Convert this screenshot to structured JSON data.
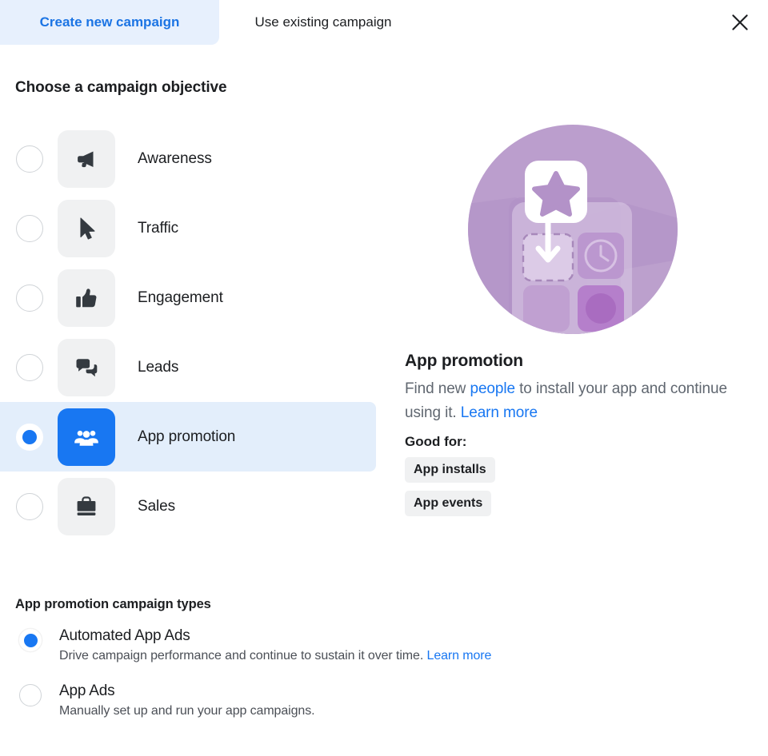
{
  "tabs": {
    "create_new": "Create new campaign",
    "use_existing": "Use existing campaign",
    "close_icon": "close-icon"
  },
  "objective_section": {
    "title": "Choose a campaign objective",
    "items": [
      {
        "label": "Awareness",
        "icon": "megaphone-icon",
        "selected": false
      },
      {
        "label": "Traffic",
        "icon": "cursor-icon",
        "selected": false
      },
      {
        "label": "Engagement",
        "icon": "thumbs-up-icon",
        "selected": false
      },
      {
        "label": "Leads",
        "icon": "chat-bubbles-icon",
        "selected": false
      },
      {
        "label": "App promotion",
        "icon": "people-icon",
        "selected": true
      },
      {
        "label": "Sales",
        "icon": "briefcase-icon",
        "selected": false
      }
    ]
  },
  "detail_panel": {
    "illustration": "app-promotion-illustration",
    "title": "App promotion",
    "desc_part1": "Find new ",
    "desc_link1": "people",
    "desc_part2": " to install your app and continue using it. ",
    "desc_link2": "Learn more",
    "good_for_label": "Good for:",
    "chips": [
      "App installs",
      "App events"
    ]
  },
  "types_section": {
    "title": "App promotion campaign types",
    "items": [
      {
        "label": "Automated App Ads",
        "desc": "Drive campaign performance and continue to sustain it over time. ",
        "link": "Learn more",
        "selected": true
      },
      {
        "label": "App Ads",
        "desc": "Manually set up and run your app campaigns.",
        "link": "",
        "selected": false
      }
    ]
  },
  "colors": {
    "accent_blue": "#1877f2",
    "link_blue": "#1b74e4",
    "tab_active_bg": "#e7f0fd",
    "row_selected_bg": "#e3eefb",
    "tile_bg": "#f0f1f2",
    "illustration_purple": "#b99ccb",
    "text_primary": "#1c1e21",
    "text_secondary": "#606770"
  }
}
